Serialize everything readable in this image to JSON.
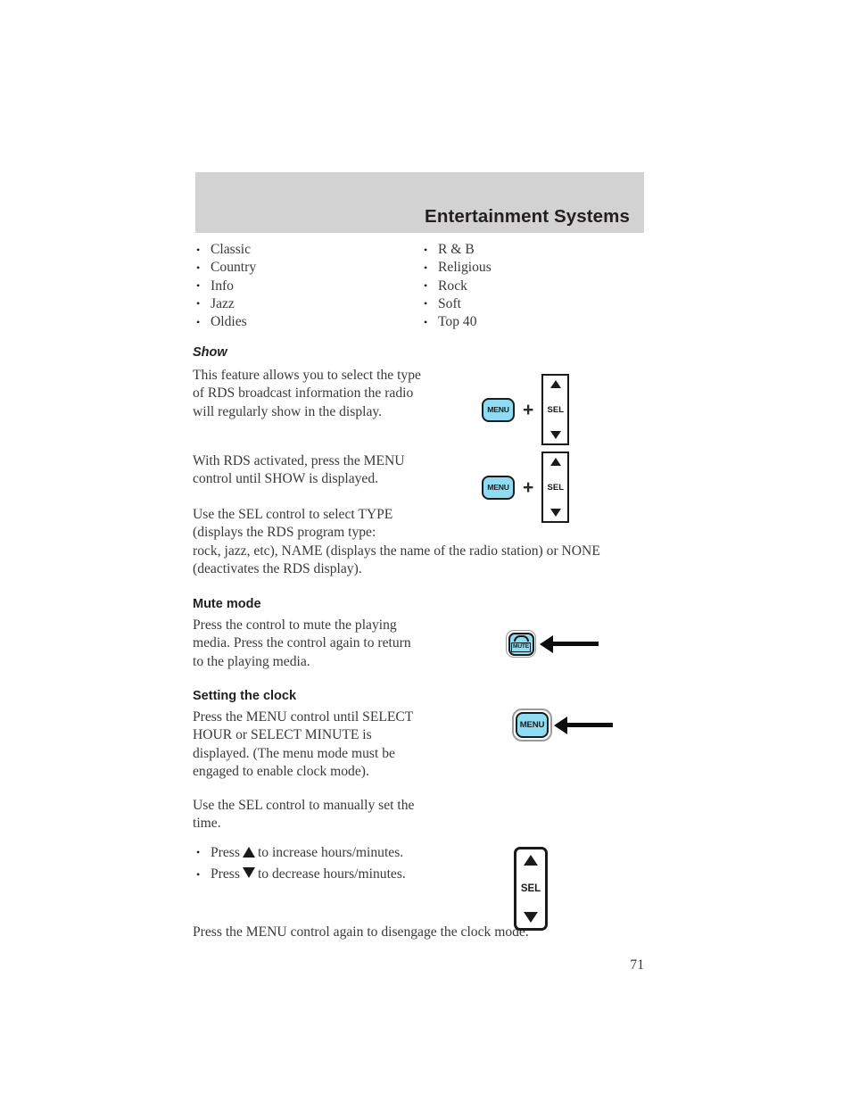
{
  "header": {
    "title": "Entertainment Systems"
  },
  "genres": {
    "left": [
      "Classic",
      "Country",
      "Info",
      "Jazz",
      "Oldies"
    ],
    "right": [
      "R & B",
      "Religious",
      "Rock",
      "Soft",
      "Top 40"
    ]
  },
  "sections": {
    "show": {
      "heading": "Show",
      "paragraph_1": "This feature allows you to select the type of RDS broadcast information the radio will regularly show in the display.",
      "paragraph_2": "With RDS activated, press the MENU control until SHOW is displayed.",
      "paragraph_3": "Use the SEL control to select TYPE (displays the RDS program type:",
      "paragraph_4": "rock, jazz, etc), NAME (displays the name of the radio station) or NONE (deactivates the RDS display)."
    },
    "mute": {
      "heading": "Mute mode",
      "paragraph_1": "Press the control to mute the playing media. Press the control again to return to the playing media."
    },
    "clock": {
      "heading": "Setting the clock",
      "paragraph_1": "Press the MENU control until SELECT HOUR or SELECT MINUTE is displayed. (The menu mode must be engaged to enable clock mode).",
      "paragraph_2": "Use the SEL control to manually set the time.",
      "bullet_1_pre": "Press",
      "bullet_1_post": "to increase hours/minutes.",
      "bullet_2_pre": "Press",
      "bullet_2_post": "to decrease hours/minutes.",
      "paragraph_3": "Press the MENU control again to disengage the clock mode."
    }
  },
  "controls": {
    "menu_label": "MENU",
    "sel_label": "SEL",
    "mute_label": "MUTE",
    "plus_symbol": "+"
  },
  "colors": {
    "button_cyan": "#8fdcf2",
    "header_gray": "#d2d2d2",
    "ink": "#231f20"
  },
  "footer": {
    "page_number": "71"
  }
}
